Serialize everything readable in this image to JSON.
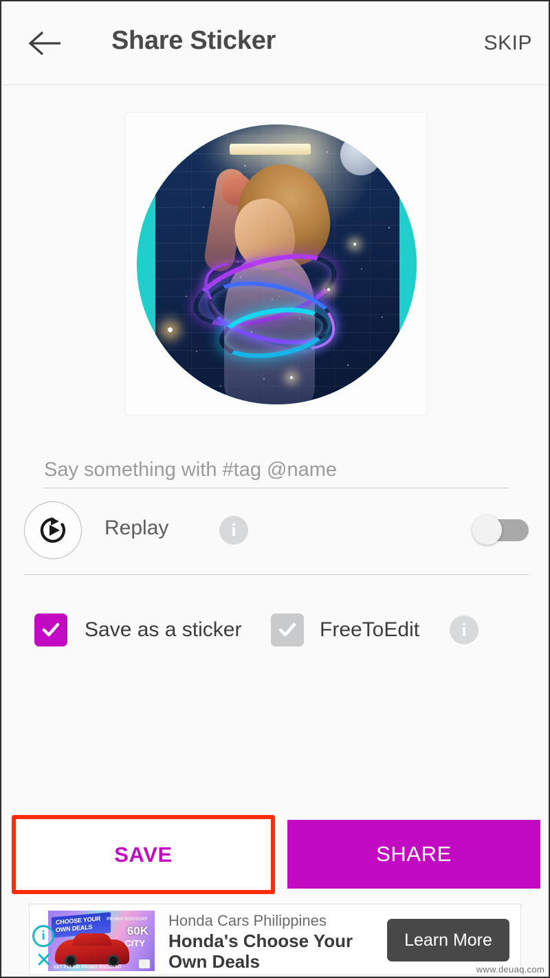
{
  "header": {
    "back_icon": "arrow-left-icon",
    "title": "Share Sticker",
    "skip_label": "SKIP"
  },
  "preview": {
    "alt": "sticker-preview",
    "background_color": "#20cfcb",
    "description": "Circular sticker: woman with neon light swirls on starry brick wall"
  },
  "caption": {
    "value": "",
    "placeholder": "Say something with #tag @name"
  },
  "replay": {
    "icon": "replay-icon",
    "label": "Replay",
    "info_icon": "info-icon",
    "info_glyph": "i",
    "toggle_on": false
  },
  "options": {
    "save_sticker": {
      "label": "Save as a sticker",
      "checked": true,
      "check_glyph": "✓",
      "color": "#c20ac2"
    },
    "free_to_edit": {
      "label": "FreeToEdit",
      "checked": true,
      "disabled": true,
      "check_glyph": "✓",
      "color": "#c9cacb"
    },
    "info_icon": "info-icon",
    "info_glyph": "i"
  },
  "actions": {
    "save_label": "SAVE",
    "share_label": "SHARE",
    "accent_color": "#c20ac2",
    "highlight_color": "#fc2d0d"
  },
  "ad": {
    "advertiser": "Honda Cars Philippines",
    "headline": "Honda's Choose Your Own Deals",
    "cta_label": "Learn More",
    "adchoices_glyph": "i",
    "close_glyph": "✕",
    "creative": {
      "headline_text": "CHOOSE YOUR OWN DEALS",
      "promo_label": "PROMO DISCOUNT",
      "promo_amount": "60K",
      "model": "CITY",
      "footer_text": "GET P10,000 PROMO DISCOUNT"
    }
  },
  "watermark": "www.deuaq.com"
}
